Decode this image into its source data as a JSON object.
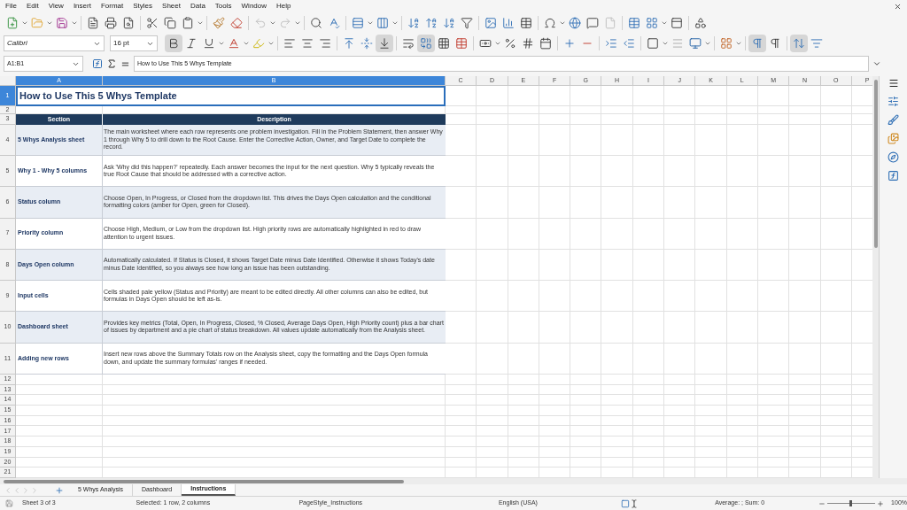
{
  "menu": [
    "File",
    "Edit",
    "View",
    "Insert",
    "Format",
    "Styles",
    "Sheet",
    "Data",
    "Tools",
    "Window",
    "Help"
  ],
  "standard_toolbar": {
    "undo_disabled": true,
    "redo_disabled": true
  },
  "format_toolbar": {
    "font_name": "Calibri",
    "font_size": "16 pt",
    "bold": true,
    "italic": false,
    "underline": false,
    "align_bottom": true,
    "merge_and_center": true,
    "left_to_right": true,
    "stacked_text": true
  },
  "formula_bar": {
    "name_box": "A1:B1",
    "content": "How to Use This 5 Whys Template"
  },
  "columns": [
    {
      "label": "A",
      "selected": true
    },
    {
      "label": "B",
      "selected": true
    },
    {
      "label": "C",
      "selected": false
    },
    {
      "label": "D",
      "selected": false
    },
    {
      "label": "E",
      "selected": false
    },
    {
      "label": "F",
      "selected": false
    },
    {
      "label": "G",
      "selected": false
    },
    {
      "label": "H",
      "selected": false
    },
    {
      "label": "I",
      "selected": false
    },
    {
      "label": "J",
      "selected": false
    },
    {
      "label": "K",
      "selected": false
    },
    {
      "label": "L",
      "selected": false
    },
    {
      "label": "M",
      "selected": false
    },
    {
      "label": "N",
      "selected": false
    },
    {
      "label": "O",
      "selected": false
    },
    {
      "label": "P",
      "selected": false
    }
  ],
  "rows": [
    {
      "number": "1",
      "selected": true,
      "kind": "title",
      "text": "How to Use This 5 Whys Template"
    },
    {
      "number": "2",
      "selected": false,
      "kind": "gap"
    },
    {
      "number": "3",
      "selected": false,
      "kind": "header",
      "cells": [
        "Section",
        "Description"
      ]
    },
    {
      "number": "4",
      "selected": false,
      "kind": "entry",
      "shaded": true,
      "section": "5 Whys Analysis sheet",
      "description": "The main worksheet where each row represents one problem investigation. Fill in the Problem Statement, then answer Why 1 through Why 5 to drill down to the Root Cause. Enter the Corrective Action, Owner, and Target Date to complete the record."
    },
    {
      "number": "5",
      "selected": false,
      "kind": "entry",
      "shaded": false,
      "section": "Why 1 - Why 5 columns",
      "description": "Ask 'Why did this happen?' repeatedly. Each answer becomes the input for the next question. Why 5 typically reveals the true Root Cause that should be addressed with a corrective action."
    },
    {
      "number": "6",
      "selected": false,
      "kind": "entry",
      "shaded": true,
      "section": "Status column",
      "description": "Choose Open, In Progress, or Closed from the dropdown list. This drives the Days Open calculation and the conditional formatting colors (amber for Open, green for Closed)."
    },
    {
      "number": "7",
      "selected": false,
      "kind": "entry",
      "shaded": false,
      "section": "Priority column",
      "description": "Choose High, Medium, or Low from the dropdown list. High priority rows are automatically highlighted in red to draw attention to urgent issues."
    },
    {
      "number": "8",
      "selected": false,
      "kind": "entry",
      "shaded": true,
      "section": "Days Open column",
      "description": "Automatically calculated. If Status is Closed, it shows Target Date minus Date Identified. Otherwise it shows Today's date minus Date Identified, so you always see how long an issue has been outstanding."
    },
    {
      "number": "9",
      "selected": false,
      "kind": "entry",
      "shaded": false,
      "section": "Input cells",
      "description": "Cells shaded pale yellow (Status and Priority) are meant to be edited directly. All other columns can also be edited, but formulas in Days Open should be left as-is."
    },
    {
      "number": "10",
      "selected": false,
      "kind": "entry",
      "shaded": true,
      "section": "Dashboard sheet",
      "description": "Provides key metrics (Total, Open, In Progress, Closed, % Closed, Average Days Open, High Priority count) plus a bar chart of issues by department and a pie chart of status breakdown. All values update automatically from the Analysis sheet."
    },
    {
      "number": "11",
      "selected": false,
      "kind": "entry",
      "shaded": false,
      "section": "Adding new rows",
      "description": "Insert new rows above the Summary Totals row on the Analysis sheet, copy the formatting and the Days Open formula down, and update the summary formulas' ranges if needed."
    },
    {
      "number": "12",
      "selected": false,
      "kind": "empty"
    },
    {
      "number": "13",
      "selected": false,
      "kind": "empty"
    },
    {
      "number": "14",
      "selected": false,
      "kind": "empty"
    },
    {
      "number": "15",
      "selected": false,
      "kind": "empty"
    },
    {
      "number": "16",
      "selected": false,
      "kind": "empty"
    },
    {
      "number": "17",
      "selected": false,
      "kind": "empty"
    },
    {
      "number": "18",
      "selected": false,
      "kind": "empty"
    },
    {
      "number": "19",
      "selected": false,
      "kind": "empty"
    },
    {
      "number": "20",
      "selected": false,
      "kind": "empty"
    },
    {
      "number": "21",
      "selected": false,
      "kind": "empty"
    }
  ],
  "sheet_tabs": [
    {
      "label": "5 Whys Analysis",
      "selected": false
    },
    {
      "label": "Dashboard",
      "selected": false
    },
    {
      "label": "Instructions",
      "selected": true
    }
  ],
  "status_bar": {
    "sheet": "Sheet 3 of 3",
    "selection": "Selected: 1 row, 2 columns",
    "page_style": "PageStyle_Instructions",
    "language": "English (USA)",
    "sum": "Average: ; Sum: 0",
    "zoom": "100%",
    "zoom_slider": {
      "level": 0.5
    }
  }
}
